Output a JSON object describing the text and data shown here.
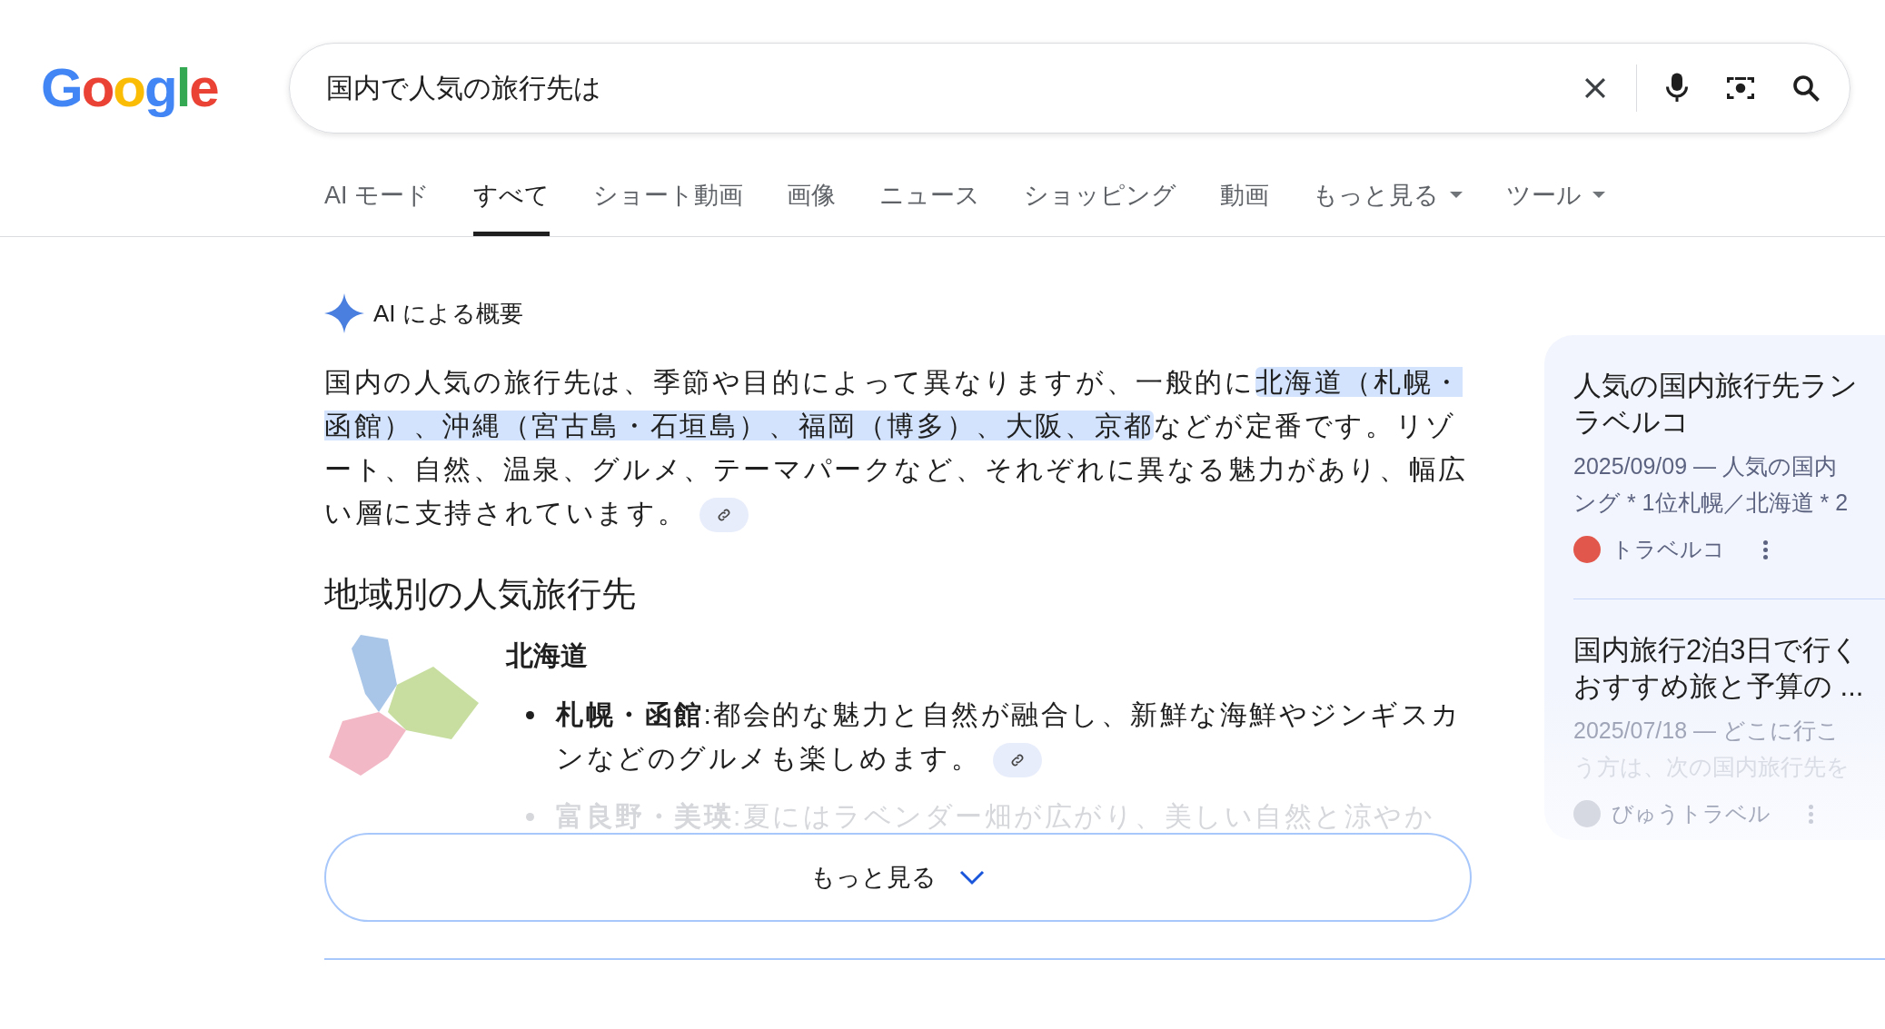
{
  "logo": "Google",
  "search": {
    "value": "国内で人気の旅行先は"
  },
  "tabs": [
    {
      "label": "AI モード",
      "selected": false,
      "kind": "plain"
    },
    {
      "label": "すべて",
      "selected": true,
      "kind": "plain"
    },
    {
      "label": "ショート動画",
      "selected": false,
      "kind": "plain"
    },
    {
      "label": "画像",
      "selected": false,
      "kind": "plain"
    },
    {
      "label": "ニュース",
      "selected": false,
      "kind": "plain"
    },
    {
      "label": "ショッピング",
      "selected": false,
      "kind": "plain"
    },
    {
      "label": "動画",
      "selected": false,
      "kind": "plain"
    },
    {
      "label": "もっと見る",
      "selected": false,
      "kind": "dropdown"
    },
    {
      "label": "ツール",
      "selected": false,
      "kind": "dropdown"
    }
  ],
  "ai_overview": {
    "title": "AI による概要",
    "summary": [
      {
        "text": "国内の人気の旅行先は、季節や目的によって異なりますが、一般的に",
        "highlighted": false
      },
      {
        "text": "北海道（札幌・函館）、沖縄（宮古島・石垣島）、福岡（博多）、大阪、京都",
        "highlighted": true
      },
      {
        "text": "などが定番です。リゾート、自然、温泉、グルメ、テーマパークなど、それぞれに異なる魅力があり、幅広い層に支持されています。",
        "highlighted": false
      }
    ],
    "heading": "地域別の人気旅行先",
    "region": {
      "name": "北海道",
      "bullets": [
        {
          "text": "**札幌・函館**:都会的な魅力と自然が融合し、新鮮な海鮮やジンギスカンなどのグルメも楽しめます。",
          "faded": false,
          "link": true
        },
        {
          "text": "**富良野・美瑛**:夏にはラベンダー畑が広がり、美しい自然と涼やか",
          "faded": true,
          "link": false
        }
      ]
    },
    "more_button": "もっと見る"
  },
  "sources": [
    {
      "title_lines": [
        "人気の国内旅行先ラン",
        "ラベルコ"
      ],
      "snippet_lines": [
        "2025/09/09 — 人気の国内",
        "ング * 1位札幌／北海道 * 2"
      ],
      "site": "トラベルコ",
      "faded": false
    },
    {
      "title_lines": [
        "国内旅行2泊3日で行く",
        "おすすめ旅と予算の ..."
      ],
      "snippet_lines": [
        "2025/07/18 — どこに行こ",
        "う方は、次の国内旅行先を"
      ],
      "site": "びゅうトラベル",
      "faded": true
    }
  ]
}
